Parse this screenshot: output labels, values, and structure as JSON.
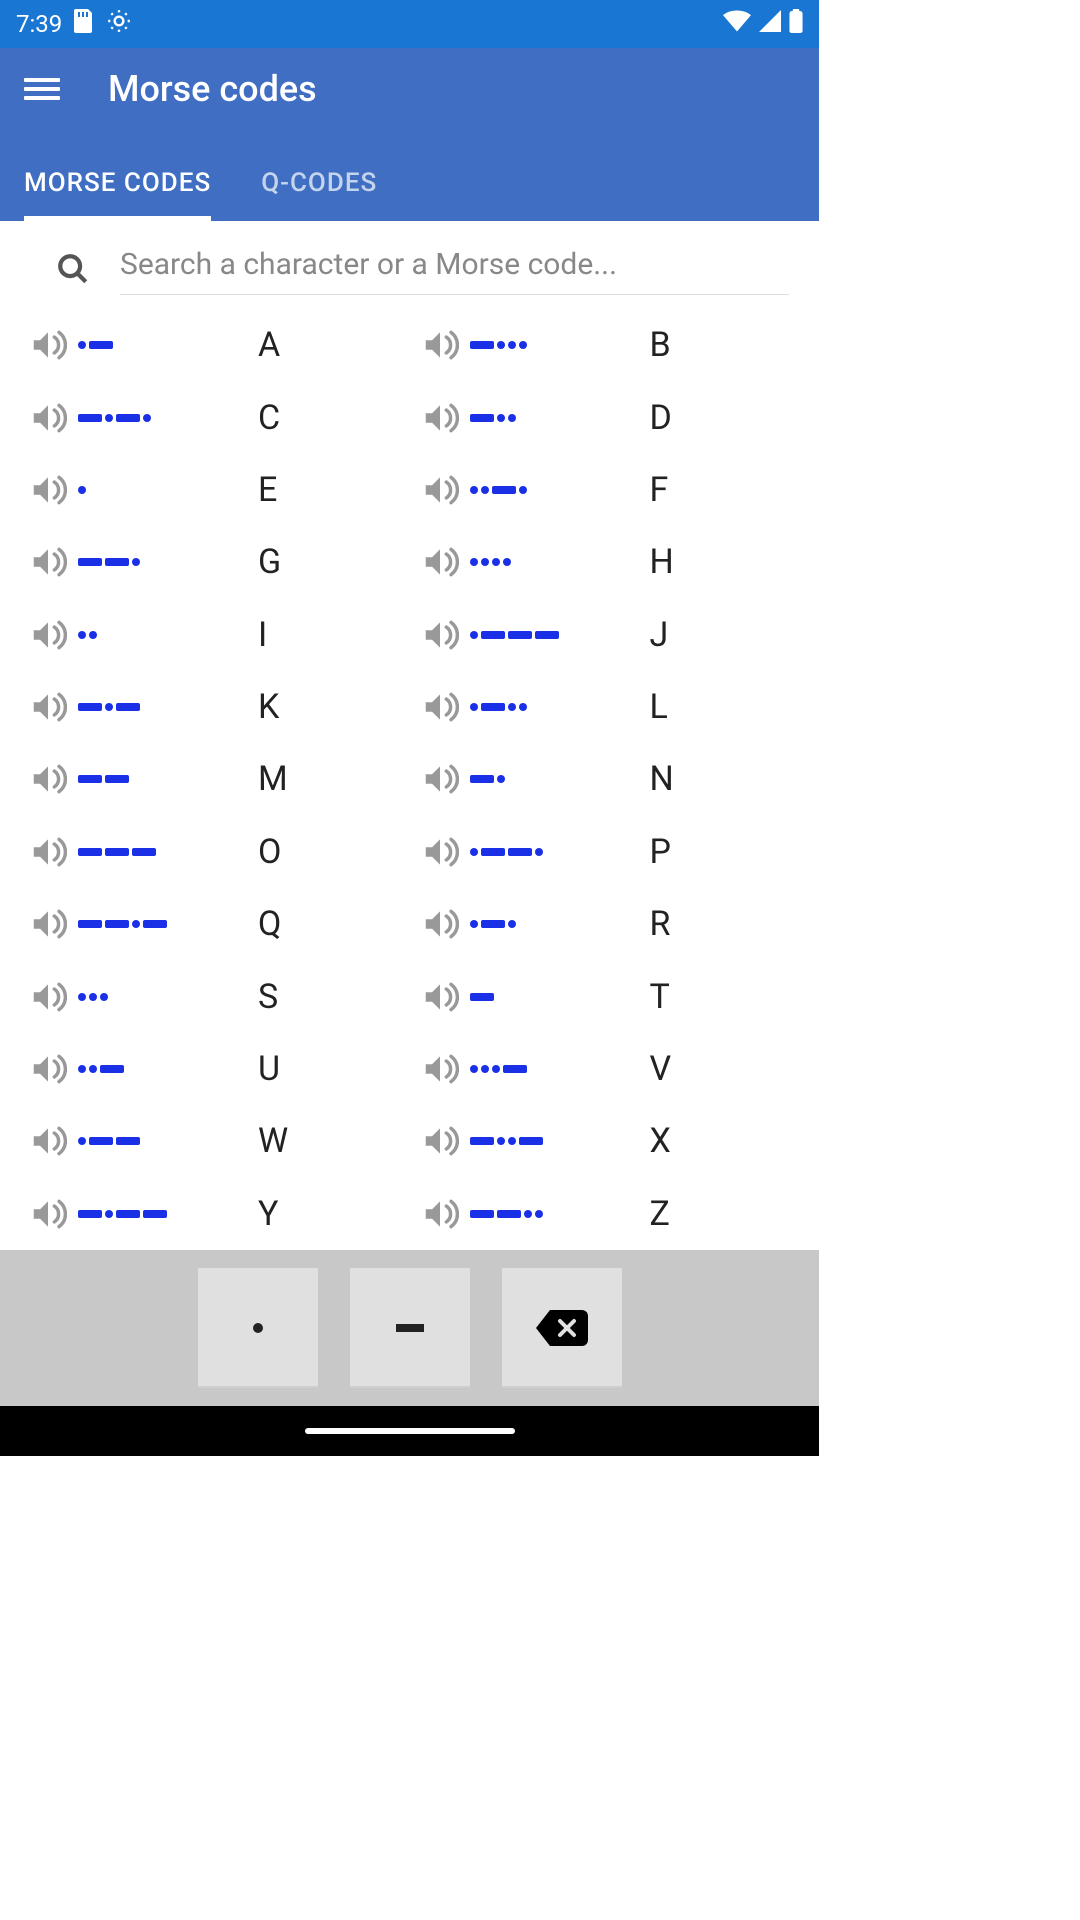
{
  "status": {
    "time": "7:39"
  },
  "appbar": {
    "title": "Morse codes"
  },
  "tabs": [
    {
      "label": "MORSE CODES",
      "active": true
    },
    {
      "label": "Q-CODES",
      "active": false
    }
  ],
  "search": {
    "placeholder": "Search a character or a Morse code..."
  },
  "codes": [
    {
      "morse": ".-",
      "letter": "A"
    },
    {
      "morse": "-...",
      "letter": "B"
    },
    {
      "morse": "-.-.",
      "letter": "C"
    },
    {
      "morse": "-..",
      "letter": "D"
    },
    {
      "morse": ".",
      "letter": "E"
    },
    {
      "morse": "..-.",
      "letter": "F"
    },
    {
      "morse": "--.",
      "letter": "G"
    },
    {
      "morse": "....",
      "letter": "H"
    },
    {
      "morse": "..",
      "letter": "I"
    },
    {
      "morse": ".---",
      "letter": "J"
    },
    {
      "morse": "-.-",
      "letter": "K"
    },
    {
      "morse": ".-..",
      "letter": "L"
    },
    {
      "morse": "--",
      "letter": "M"
    },
    {
      "morse": "-.",
      "letter": "N"
    },
    {
      "morse": "---",
      "letter": "O"
    },
    {
      "morse": ".--.",
      "letter": "P"
    },
    {
      "morse": "--.-",
      "letter": "Q"
    },
    {
      "morse": ".-.",
      "letter": "R"
    },
    {
      "morse": "...",
      "letter": "S"
    },
    {
      "morse": "-",
      "letter": "T"
    },
    {
      "morse": "..-",
      "letter": "U"
    },
    {
      "morse": "...-",
      "letter": "V"
    },
    {
      "morse": ".--",
      "letter": "W"
    },
    {
      "morse": "-..-",
      "letter": "X"
    },
    {
      "morse": "-.--",
      "letter": "Y"
    },
    {
      "morse": "--..",
      "letter": "Z"
    }
  ]
}
